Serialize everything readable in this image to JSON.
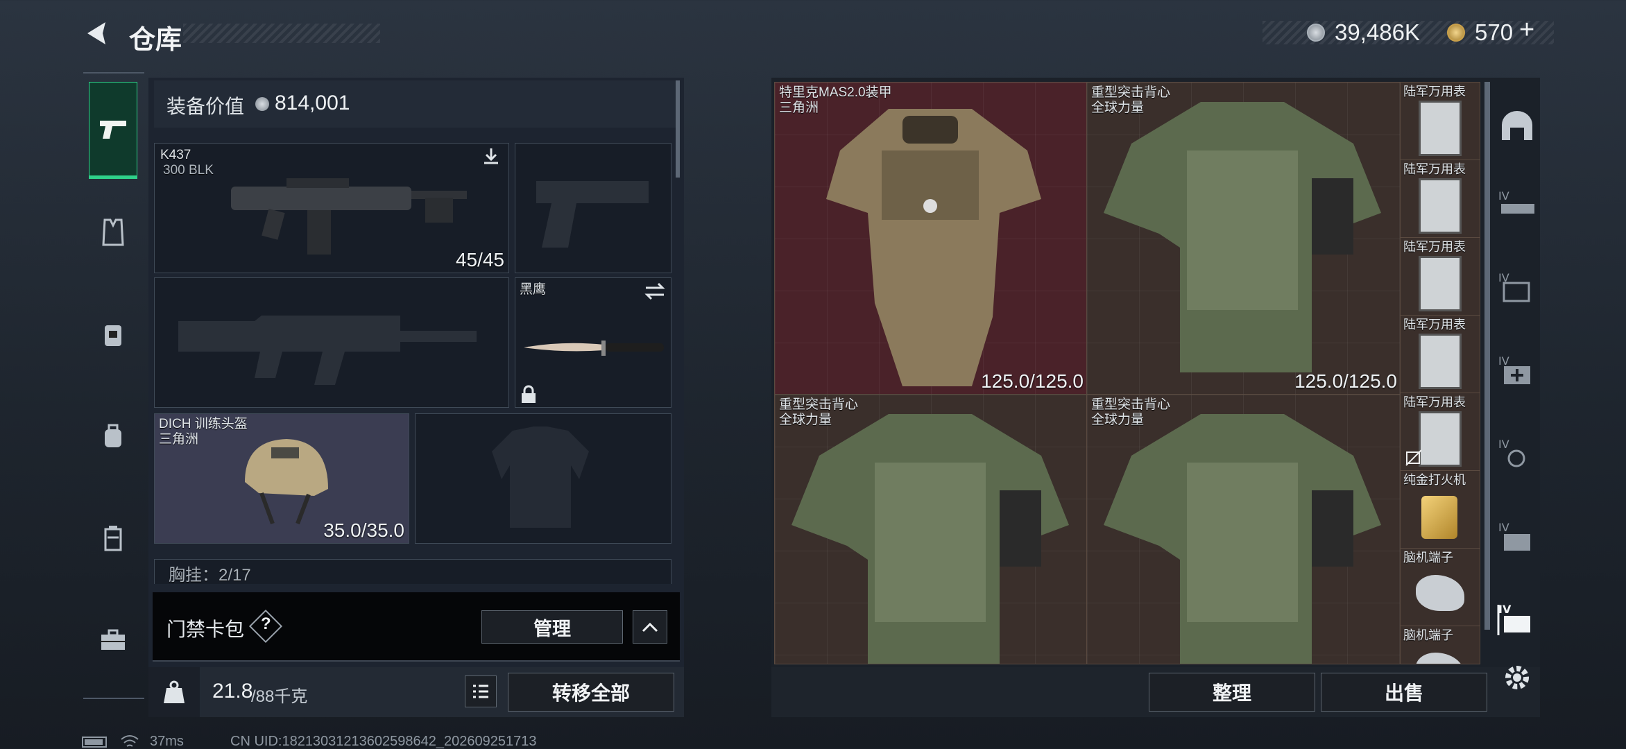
{
  "header": {
    "title": "仓库",
    "currency_silver": "39,486K",
    "currency_gold": "570",
    "plus": "+"
  },
  "equipment": {
    "value_label": "装备价值",
    "value": "814,001",
    "primary_weapon": {
      "name": "K437",
      "ammo": "300 BLK",
      "count": "45/45"
    },
    "melee": {
      "name": "黑鹰"
    },
    "helmet": {
      "name": "DICH 训练头盔",
      "origin": "三角洲",
      "durability": "35.0/35.0"
    },
    "chest_rig_partial": "胸挂：2/17"
  },
  "keycard": {
    "label": "门禁卡包",
    "help": "?",
    "manage": "管理"
  },
  "weight": {
    "current": "21.8",
    "max": "/88千克"
  },
  "transfer_all": "转移全部",
  "storage": {
    "items": [
      {
        "name": "特里克MAS2.0装甲",
        "origin": "三角洲",
        "durability": "125.0/125.0"
      },
      {
        "name": "重型突击背心",
        "origin": "全球力量",
        "durability": "125.0/125.0"
      },
      {
        "name": "重型突击背心",
        "origin": "全球力量"
      },
      {
        "name": "重型突击背心",
        "origin": "全球力量"
      }
    ],
    "small_items": [
      "陆军万用表",
      "陆军万用表",
      "陆军万用表",
      "陆军万用表",
      "陆军万用表",
      "纯金打火机",
      "脑机端子",
      "脑机端子"
    ],
    "organize": "整理",
    "sell": "出售"
  },
  "status": {
    "ping": "37ms",
    "uid": "CN UID:182130312136025986​42_202609251713"
  },
  "colors": {
    "accent": "#2fd18a",
    "armor_bg": "#4a2229",
    "vest_bg": "#3a2f2b"
  }
}
